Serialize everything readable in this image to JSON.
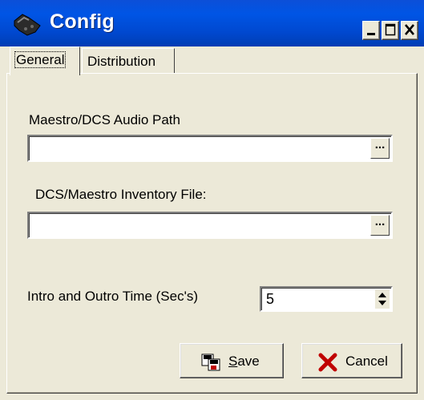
{
  "window": {
    "title": "Config",
    "icon": "game-controller-icon",
    "buttons": {
      "minimize": "minimize-icon",
      "maximize": "maximize-icon",
      "close": "close-icon"
    }
  },
  "tabs": [
    {
      "label": "General",
      "active": true
    },
    {
      "label": "Distribution",
      "active": false
    }
  ],
  "general": {
    "audio_path_label": "Maestro/DCS Audio Path",
    "audio_path_value": "",
    "inventory_label": "DCS/Maestro Inventory File:",
    "inventory_value": "",
    "browse_label": "...",
    "intro_outro_label": "Intro and Outro Time (Sec's)",
    "intro_outro_value": "5"
  },
  "actions": {
    "save_first": "S",
    "save_rest": "ave",
    "cancel_label": "Cancel"
  },
  "colors": {
    "title_bar": "#0055e5",
    "face": "#ece9d8",
    "cancel_x": "#c00000"
  }
}
